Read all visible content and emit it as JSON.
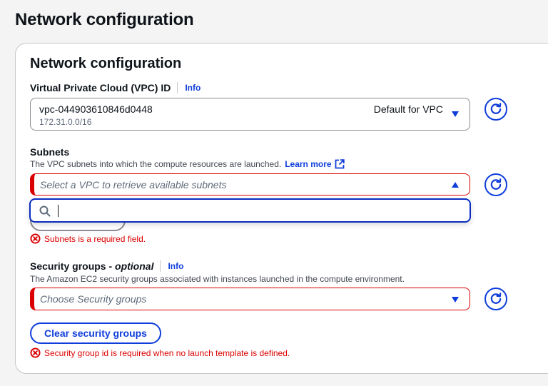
{
  "page": {
    "title": "Network configuration"
  },
  "panel": {
    "title": "Network configuration"
  },
  "vpc": {
    "label": "Virtual Private Cloud (VPC) ID",
    "info": "Info",
    "selected_id": "vpc-044903610846d0448",
    "selected_cidr": "172.31.0.0/16",
    "selected_tag": "Default for VPC"
  },
  "subnets": {
    "label": "Subnets",
    "description": "The VPC subnets into which the compute resources are launched.",
    "learn_more": "Learn more",
    "placeholder": "Select a VPC to retrieve available subnets",
    "search_value": "",
    "error": "Subnets is a required field."
  },
  "security_groups": {
    "label": "Security groups - ",
    "label_optional": "optional",
    "info": "Info",
    "description": "The Amazon EC2 security groups associated with instances launched in the compute environment.",
    "placeholder": "Choose Security groups",
    "clear_button": "Clear security groups",
    "error": "Security group id is required when no launch template is defined."
  },
  "icons": {
    "refresh": "refresh-icon",
    "caret_down": "caret-down-icon",
    "caret_up": "caret-up-icon",
    "search": "search-icon",
    "external": "external-link-icon",
    "error": "error-icon"
  },
  "colors": {
    "link": "#0f3ddb",
    "error": "#db0000",
    "border": "#8c8c94",
    "focus": "#0a2cc1"
  }
}
